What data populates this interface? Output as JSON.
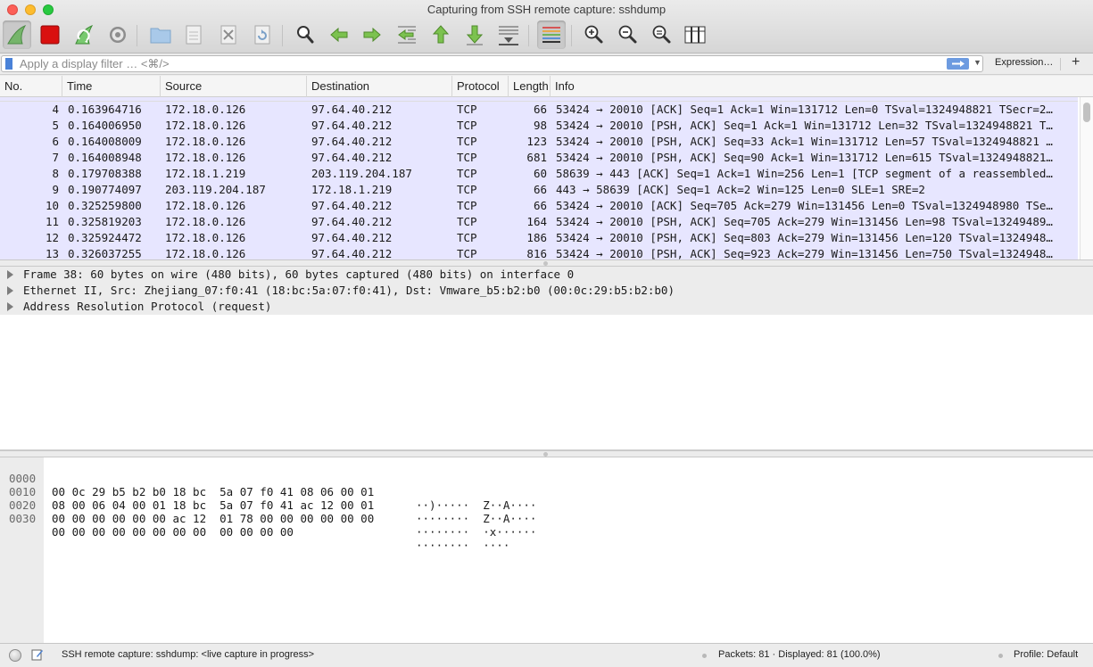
{
  "window": {
    "title": "Capturing from SSH remote capture: sshdump"
  },
  "toolbar": {
    "buttons": [
      {
        "name": "start-capture",
        "icon": "shark-fin-icon"
      },
      {
        "name": "stop-capture",
        "icon": "stop-square-icon"
      },
      {
        "name": "restart-capture",
        "icon": "restart-shark-icon"
      },
      {
        "name": "capture-options",
        "icon": "gear-icon"
      },
      {
        "name": "open-file",
        "icon": "folder-icon"
      },
      {
        "name": "save-file",
        "icon": "save-document-icon"
      },
      {
        "name": "close-file",
        "icon": "close-document-icon"
      },
      {
        "name": "reload-file",
        "icon": "reload-icon"
      },
      {
        "name": "find-packet",
        "icon": "magnifier-icon"
      },
      {
        "name": "go-back",
        "icon": "arrow-left-icon"
      },
      {
        "name": "go-forward",
        "icon": "arrow-right-icon"
      },
      {
        "name": "go-to-packet",
        "icon": "goto-packet-icon"
      },
      {
        "name": "go-to-first",
        "icon": "arrow-up-icon"
      },
      {
        "name": "go-to-last",
        "icon": "arrow-down-icon"
      },
      {
        "name": "auto-scroll",
        "icon": "autoscroll-icon"
      },
      {
        "name": "colorize",
        "icon": "colorize-lines-icon"
      },
      {
        "name": "zoom-in",
        "icon": "zoom-in-icon"
      },
      {
        "name": "zoom-out",
        "icon": "zoom-out-icon"
      },
      {
        "name": "normal-size",
        "icon": "zoom-reset-icon"
      },
      {
        "name": "resize-columns",
        "icon": "resize-columns-icon"
      }
    ]
  },
  "filter": {
    "placeholder": "Apply a display filter … <⌘/>",
    "value": "",
    "expression_label": "Expression…",
    "add_label": "+"
  },
  "packet_list": {
    "columns": [
      "No.",
      "Time",
      "Source",
      "Destination",
      "Protocol",
      "Length",
      "Info"
    ],
    "rows": [
      {
        "no": "4",
        "time": "0.163964716",
        "src": "172.18.0.126",
        "dst": "97.64.40.212",
        "proto": "TCP",
        "len": "66",
        "info": "53424 → 20010 [ACK] Seq=1 Ack=1 Win=131712 Len=0 TSval=1324948821 TSecr=2…"
      },
      {
        "no": "5",
        "time": "0.164006950",
        "src": "172.18.0.126",
        "dst": "97.64.40.212",
        "proto": "TCP",
        "len": "98",
        "info": "53424 → 20010 [PSH, ACK] Seq=1 Ack=1 Win=131712 Len=32 TSval=1324948821 T…"
      },
      {
        "no": "6",
        "time": "0.164008009",
        "src": "172.18.0.126",
        "dst": "97.64.40.212",
        "proto": "TCP",
        "len": "123",
        "info": "53424 → 20010 [PSH, ACK] Seq=33 Ack=1 Win=131712 Len=57 TSval=1324948821 …"
      },
      {
        "no": "7",
        "time": "0.164008948",
        "src": "172.18.0.126",
        "dst": "97.64.40.212",
        "proto": "TCP",
        "len": "681",
        "info": "53424 → 20010 [PSH, ACK] Seq=90 Ack=1 Win=131712 Len=615 TSval=1324948821…"
      },
      {
        "no": "8",
        "time": "0.179708388",
        "src": "172.18.1.219",
        "dst": "203.119.204.187",
        "proto": "TCP",
        "len": "60",
        "info": "58639 → 443 [ACK] Seq=1 Ack=1 Win=256 Len=1 [TCP segment of a reassembled…"
      },
      {
        "no": "9",
        "time": "0.190774097",
        "src": "203.119.204.187",
        "dst": "172.18.1.219",
        "proto": "TCP",
        "len": "66",
        "info": "443 → 58639 [ACK] Seq=1 Ack=2 Win=125 Len=0 SLE=1 SRE=2"
      },
      {
        "no": "10",
        "time": "0.325259800",
        "src": "172.18.0.126",
        "dst": "97.64.40.212",
        "proto": "TCP",
        "len": "66",
        "info": "53424 → 20010 [ACK] Seq=705 Ack=279 Win=131456 Len=0 TSval=1324948980 TSe…"
      },
      {
        "no": "11",
        "time": "0.325819203",
        "src": "172.18.0.126",
        "dst": "97.64.40.212",
        "proto": "TCP",
        "len": "164",
        "info": "53424 → 20010 [PSH, ACK] Seq=705 Ack=279 Win=131456 Len=98 TSval=13249489…"
      },
      {
        "no": "12",
        "time": "0.325924472",
        "src": "172.18.0.126",
        "dst": "97.64.40.212",
        "proto": "TCP",
        "len": "186",
        "info": "53424 → 20010 [PSH, ACK] Seq=803 Ack=279 Win=131456 Len=120 TSval=1324948…"
      },
      {
        "no": "13",
        "time": "0.326037255",
        "src": "172.18.0.126",
        "dst": "97.64.40.212",
        "proto": "TCP",
        "len": "816",
        "info": "53424 → 20010 [PSH, ACK] Seq=923 Ack=279 Win=131456 Len=750 TSval=1324948…"
      }
    ],
    "row_color": "#e7e6ff"
  },
  "details": {
    "lines": [
      "Frame 38: 60 bytes on wire (480 bits), 60 bytes captured (480 bits) on interface 0",
      "Ethernet II, Src: Zhejiang_07:f0:41 (18:bc:5a:07:f0:41), Dst: Vmware_b5:b2:b0 (00:0c:29:b5:b2:b0)",
      "Address Resolution Protocol (request)"
    ]
  },
  "bytes": {
    "rows": [
      {
        "offset": "0000",
        "hex": "00 0c 29 b5 b2 b0 18 bc  5a 07 f0 41 08 06 00 01",
        "ascii": "··)·····  Z··A····"
      },
      {
        "offset": "0010",
        "hex": "08 00 06 04 00 01 18 bc  5a 07 f0 41 ac 12 00 01",
        "ascii": "········  Z··A····"
      },
      {
        "offset": "0020",
        "hex": "00 00 00 00 00 00 ac 12  01 78 00 00 00 00 00 00",
        "ascii": "········  ·x······"
      },
      {
        "offset": "0030",
        "hex": "00 00 00 00 00 00 00 00  00 00 00 00",
        "ascii": "········  ····"
      }
    ]
  },
  "status": {
    "capture_text": "SSH remote capture: sshdump: <live capture in progress>",
    "packets_text": "Packets: 81 · Displayed: 81 (100.0%)",
    "profile_text": "Profile: Default"
  }
}
